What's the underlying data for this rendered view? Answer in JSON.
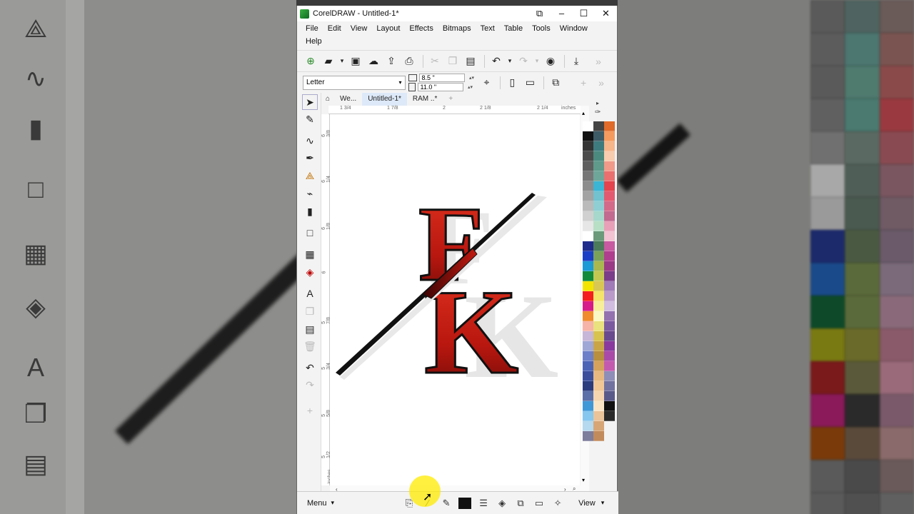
{
  "window": {
    "title": "CorelDRAW - Untitled-1*",
    "controls": [
      "⧉",
      "–",
      "☐",
      "✕"
    ]
  },
  "menu": [
    "File",
    "Edit",
    "View",
    "Layout",
    "Effects",
    "Bitmaps",
    "Text",
    "Table",
    "Tools",
    "Window",
    "Help"
  ],
  "property_bar": {
    "page_size": "Letter",
    "width": "8.5 \"",
    "height": "11.0 \""
  },
  "tabs": [
    "We...",
    "Untitled-1*",
    "RAM ..*"
  ],
  "ruler": {
    "h_ticks": [
      "1 3/4",
      "1 7/8",
      "2",
      "2 1/8",
      "2 1/4"
    ],
    "h_unit": "inches",
    "v_ticks": [
      "6 3/8",
      "6 1/4",
      "6 1/8",
      "6",
      "5 7/8",
      "5 3/4",
      "5 5/8",
      "5 1/2"
    ],
    "v_unit": "inches"
  },
  "logo": {
    "letter1": "F",
    "letter2": "K",
    "fill": "#c8211a",
    "stroke": "#111111"
  },
  "bottom_bar": {
    "menu": "Menu",
    "view": "View"
  },
  "colors": {
    "accent": "#3cb043"
  }
}
